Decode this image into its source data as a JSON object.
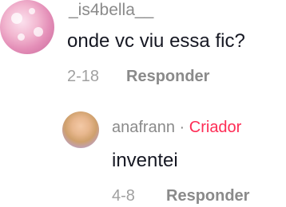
{
  "comment": {
    "username": "_is4bella__",
    "text": "onde vc viu essa fic?",
    "date": "2-18",
    "reply_label": "Responder"
  },
  "reply": {
    "username": "anafrann",
    "separator": "·",
    "badge": "Criador",
    "text": "inventei",
    "date": "4-8",
    "reply_label": "Responder"
  },
  "colors": {
    "text": "#161823",
    "secondary": "#8a8a8a",
    "creator_badge": "#fe2c55",
    "background": "#ffffff"
  }
}
